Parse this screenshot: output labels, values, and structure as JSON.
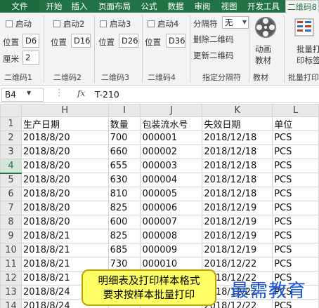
{
  "ribbon_tabs": [
    "文件",
    "开始",
    "插入",
    "页面布局",
    "公式",
    "数据",
    "审阅",
    "视图",
    "开发工具",
    "二维码8"
  ],
  "ribbon": {
    "group1": {
      "chk_label": "启动",
      "pos_label": "位置",
      "pos_value": "D6",
      "size_label": "厘米",
      "size_value": "2",
      "name": "二维码1"
    },
    "group2": {
      "chk_label": "启动2",
      "pos_label": "位置",
      "pos_value": "D16",
      "name": "二维码2"
    },
    "group3": {
      "chk_label": "启动3",
      "pos_label": "位置",
      "pos_value": "D26",
      "name": "二维码3"
    },
    "group4": {
      "chk_label": "启动4",
      "pos_label": "位置",
      "pos_value": "D36",
      "name": "二维码4"
    },
    "group5": {
      "sep_label": "分隔符",
      "sep_value": "无",
      "delete_btn": "删除二维码",
      "update_btn": "更新二维码",
      "name": "指定分隔符"
    },
    "group6": {
      "btn_line1": "动画",
      "btn_line2": "教材",
      "name": "教材"
    },
    "group7": {
      "btn_line1": "批量打",
      "btn_line2": "印标签",
      "name": "批量打印"
    }
  },
  "formula_bar": {
    "cell_ref": "B4",
    "fx": "fx",
    "value": "T-210"
  },
  "grid": {
    "columns": [
      "H",
      "I",
      "J",
      "K",
      "L"
    ],
    "selected_row": "4",
    "rows": [
      {
        "num": "1",
        "cells": [
          "生产日期",
          "数量",
          "包装流水号",
          "失效日期",
          "单位"
        ]
      },
      {
        "num": "2",
        "cells": [
          "2018/8/20",
          "700",
          "000001",
          "2018/12/18",
          "PCS"
        ]
      },
      {
        "num": "3",
        "cells": [
          "2018/8/20",
          "660",
          "000002",
          "2018/12/18",
          "PCS"
        ]
      },
      {
        "num": "4",
        "cells": [
          "2018/8/20",
          "655",
          "000003",
          "2018/12/18",
          "PCS"
        ]
      },
      {
        "num": "5",
        "cells": [
          "2018/8/20",
          "630",
          "000004",
          "2018/12/18",
          "PCS"
        ]
      },
      {
        "num": "6",
        "cells": [
          "2018/8/20",
          "810",
          "000005",
          "2018/12/18",
          "PCS"
        ]
      },
      {
        "num": "7",
        "cells": [
          "2018/8/20",
          "825",
          "000006",
          "2018/12/19",
          "PCS"
        ]
      },
      {
        "num": "8",
        "cells": [
          "2018/8/20",
          "600",
          "000007",
          "2018/12/19",
          "PCS"
        ]
      },
      {
        "num": "9",
        "cells": [
          "2018/8/21",
          "825",
          "000008",
          "2018/12/19",
          "PCS"
        ]
      },
      {
        "num": "10",
        "cells": [
          "2018/8/21",
          "685",
          "000009",
          "2018/12/19",
          "PCS"
        ]
      },
      {
        "num": "11",
        "cells": [
          "2018/8/21",
          "730",
          "000010",
          "2018/12/22",
          "PCS"
        ]
      },
      {
        "num": "12",
        "cells": [
          "2018/8/21",
          "",
          "",
          "2018/12/22",
          "PCS"
        ]
      },
      {
        "num": "13",
        "cells": [
          "2018/8/24",
          "",
          "",
          "2018/12/22",
          "PCS"
        ]
      },
      {
        "num": "14",
        "cells": [
          "2018/8/24",
          "",
          "",
          "2018/12/22",
          "PCS"
        ]
      }
    ]
  },
  "callout": {
    "line1": "明细表及打印样本格式",
    "line2": "要求按样本批量打印"
  },
  "watermark": "最需教育",
  "colors": {
    "accent": "#217346",
    "callout_bg": "#ffff66",
    "watermark": "#1a56d6"
  }
}
